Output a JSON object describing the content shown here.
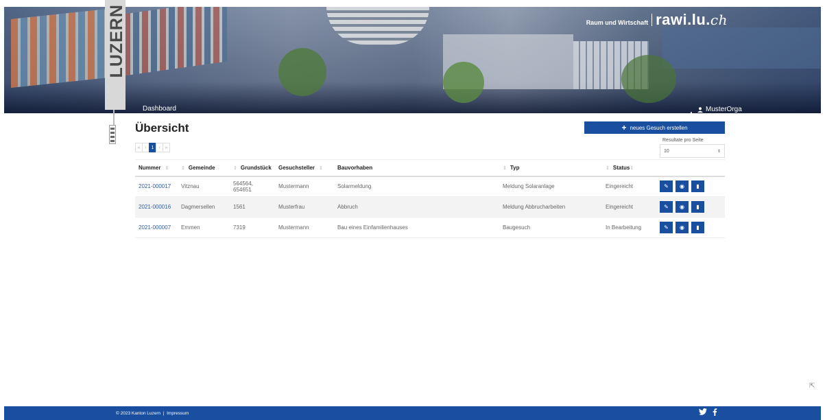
{
  "header": {
    "brand_small": "Raum und Wirtschaft",
    "brand_big": "rawi.lu.",
    "brand_ch": "ch",
    "logo_text": "LUZERN",
    "nav_dashboard": "Dashboard",
    "user_name": "MusterOrga"
  },
  "main": {
    "title": "Übersicht",
    "new_button": "neues Gesuch erstellen",
    "per_page_label": "Resultate pro Seite",
    "per_page_value": "10",
    "pagination": [
      "«",
      "‹",
      "1",
      "›",
      "»"
    ]
  },
  "table": {
    "columns": [
      "Nummer",
      "Gemeinde",
      "Grundstück",
      "Gesuchsteller",
      "Bauvorhaben",
      "Typ",
      "Status"
    ],
    "rows": [
      {
        "nummer": "2021-000017",
        "gemeinde": "Vitznau",
        "grundstueck": "564564, 654651",
        "gesuchsteller": "Mustermann",
        "bauvorhaben": "Solarmeldung",
        "typ": "Meldung Solaranlage",
        "status": "Eingereicht"
      },
      {
        "nummer": "2021-000016",
        "gemeinde": "Dagmersellen",
        "grundstueck": "1561",
        "gesuchsteller": "Musterfrau",
        "bauvorhaben": "Abbruch",
        "typ": "Meldung Abbrucharbeiten",
        "status": "Eingereicht"
      },
      {
        "nummer": "2021-000007",
        "gemeinde": "Emmen",
        "grundstueck": "7319",
        "gesuchsteller": "Mustermann",
        "bauvorhaben": "Bau eines Einfamilienhauses",
        "typ": "Baugesuch",
        "status": "In Bearbeitung"
      }
    ]
  },
  "footer": {
    "copyright": "© 2023 Kanton Luzern",
    "separator": "|",
    "impressum": "Impressum",
    "social": [
      "twitter-icon",
      "facebook-icon"
    ]
  },
  "colors": {
    "primary": "#1a4fa0",
    "link": "#2a5caa"
  }
}
